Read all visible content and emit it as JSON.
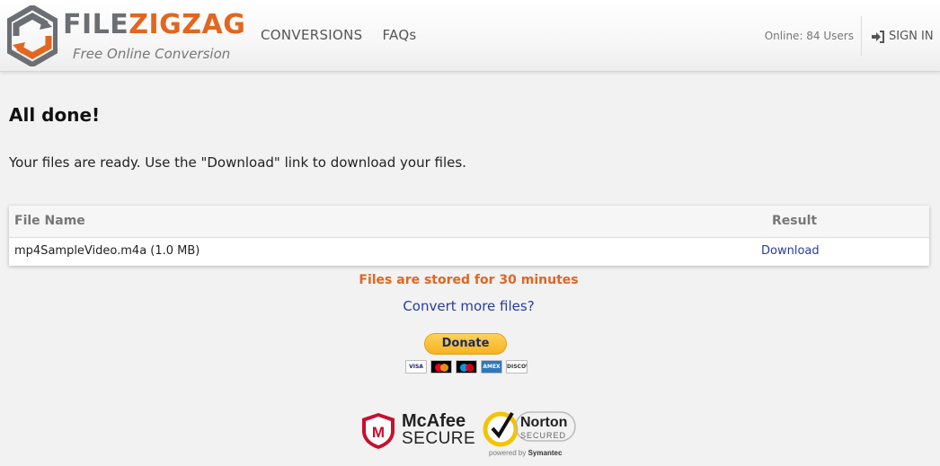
{
  "header": {
    "logo_word_1": "FILE",
    "logo_word_2": "ZIGZAG",
    "logo_tagline": "Free Online Conversion",
    "nav": [
      {
        "label": "CONVERSIONS"
      },
      {
        "label": "FAQs"
      }
    ],
    "online_users": "Online: 84 Users",
    "signin_label": "SIGN IN"
  },
  "main": {
    "title": "All done!",
    "message": "Your files are ready. Use the \"Download\" link to download your files.",
    "table": {
      "columns": [
        "File Name",
        "Result"
      ],
      "rows": [
        {
          "file_name": "mp4SampleVideo.m4a (1.0 MB)",
          "result": "Download"
        }
      ]
    },
    "storage_note": "Files are stored for 30 minutes",
    "convert_more": "Convert more files?"
  },
  "donate": {
    "button_label": "Donate",
    "cards": [
      "VISA",
      "MasterCard",
      "Maestro",
      "AMEX",
      "DISCOVER"
    ]
  },
  "badges": {
    "mcafee_name": "McAfee",
    "mcafee_secure": "SECURE",
    "norton_name": "Norton",
    "norton_secured": "SECURED",
    "norton_powered_prefix": "powered by",
    "norton_powered_brand": "Symantec"
  },
  "colors": {
    "brand_orange": "#e3661e",
    "brand_gray": "#6b6f73",
    "link_blue": "#2a3b9e",
    "note_orange": "#e0661f",
    "page_background": "#f2f2f2"
  }
}
